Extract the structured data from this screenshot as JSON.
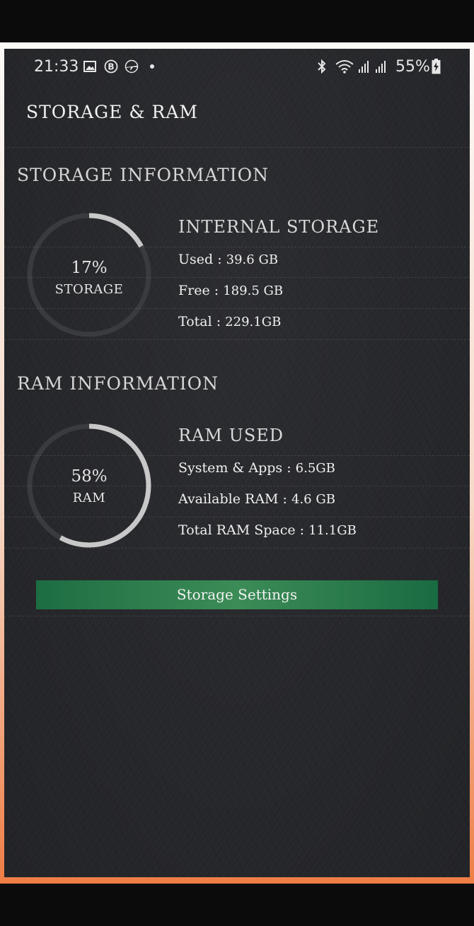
{
  "status_bar": {
    "time": "21:33",
    "battery": "55%",
    "left_icons": [
      "image-icon",
      "b-circle-icon",
      "airplane-icon",
      "dot-icon"
    ],
    "right_icons": [
      "bluetooth-icon",
      "wifi-icon",
      "signal-icon",
      "signal-icon",
      "battery-icon"
    ]
  },
  "app_bar": {
    "title": "STORAGE & RAM"
  },
  "storage": {
    "section_title": "STORAGE INFORMATION",
    "percent": "17%",
    "ring_label": "STORAGE",
    "ring_fraction": 0.17,
    "heading": "INTERNAL STORAGE",
    "rows": [
      {
        "label": "Used : ",
        "value": "39.6 GB"
      },
      {
        "label": "Free : ",
        "value": "189.5  GB"
      },
      {
        "label": "Total : ",
        "value": "229.1GB"
      }
    ]
  },
  "ram": {
    "section_title": "RAM INFORMATION",
    "percent": "58%",
    "ring_label": "RAM",
    "ring_fraction": 0.58,
    "heading": "RAM USED",
    "rows": [
      {
        "label": "System & Apps : ",
        "value": "6.5GB"
      },
      {
        "label": "Available RAM : ",
        "value": "4.6  GB"
      },
      {
        "label": "Total RAM Space : ",
        "value": "11.1GB"
      }
    ]
  },
  "button": {
    "label": "Storage Settings"
  },
  "colors": {
    "background": "#26272b",
    "ring_track": "#3a3b3f",
    "ring_fill": "#c8c8c8",
    "button": "#2e7d4f"
  }
}
